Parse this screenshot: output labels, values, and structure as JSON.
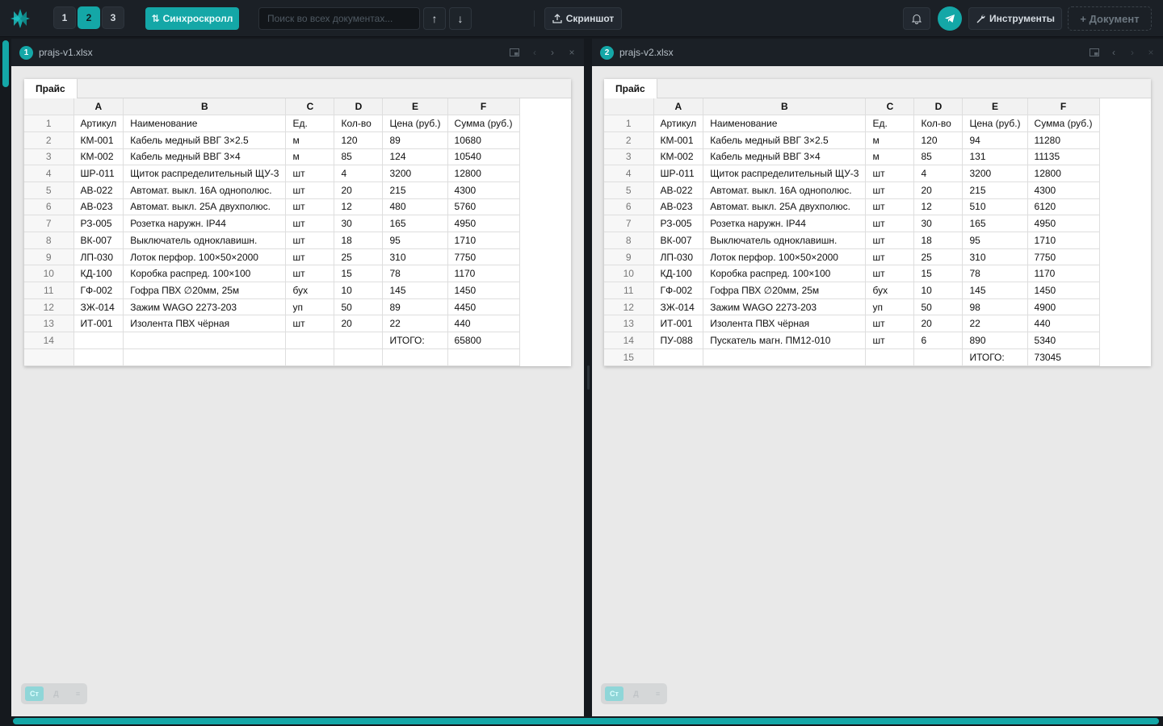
{
  "toolbar": {
    "doc_numbers": [
      "1",
      "2",
      "3"
    ],
    "active_doc": "2",
    "sync_label": "Синхроскролл",
    "search_placeholder": "Поиск во всех документах...",
    "up_arrow": "↑",
    "down_arrow": "↓",
    "screenshot_label": "Скриншот",
    "tools_label": "Инструменты",
    "add_doc_label": "+ Документ"
  },
  "colors": {
    "accent": "#14a7a7",
    "toolbar_bg": "#1b2026",
    "pane_bg": "#e9e9e9"
  },
  "left": {
    "badge": "1",
    "filename": "prajs-v1.xlsx",
    "sheet_tab": "Прайс",
    "columns": [
      "A",
      "B",
      "C",
      "D",
      "E",
      "F"
    ],
    "rows": [
      [
        "1",
        "Артикул",
        "Наименование",
        "Ед.",
        "Кол-во",
        "Цена (руб.)",
        "Сумма (руб.)"
      ],
      [
        "2",
        "КМ-001",
        "Кабель медный ВВГ 3×2.5",
        "м",
        "120",
        "89",
        "10680"
      ],
      [
        "3",
        "КМ-002",
        "Кабель медный ВВГ 3×4",
        "м",
        "85",
        "124",
        "10540"
      ],
      [
        "4",
        "ШР-011",
        "Щиток распределительный ЩУ-3",
        "шт",
        "4",
        "3200",
        "12800"
      ],
      [
        "5",
        "АВ-022",
        "Автомат. выкл. 16А однополюс.",
        "шт",
        "20",
        "215",
        "4300"
      ],
      [
        "6",
        "АВ-023",
        "Автомат. выкл. 25А двухполюс.",
        "шт",
        "12",
        "480",
        "5760"
      ],
      [
        "7",
        "РЗ-005",
        "Розетка наружн. IP44",
        "шт",
        "30",
        "165",
        "4950"
      ],
      [
        "8",
        "ВК-007",
        "Выключатель одноклавишн.",
        "шт",
        "18",
        "95",
        "1710"
      ],
      [
        "9",
        "ЛП-030",
        "Лоток перфор. 100×50×2000",
        "шт",
        "25",
        "310",
        "7750"
      ],
      [
        "10",
        "КД-100",
        "Коробка распред. 100×100",
        "шт",
        "15",
        "78",
        "1170"
      ],
      [
        "11",
        "ГФ-002",
        "Гофра ПВХ ∅20мм, 25м",
        "бух",
        "10",
        "145",
        "1450"
      ],
      [
        "12",
        "ЗЖ-014",
        "Зажим WAGO 2273-203",
        "уп",
        "50",
        "89",
        "4450"
      ],
      [
        "13",
        "ИТ-001",
        "Изолента ПВХ чёрная",
        "шт",
        "20",
        "22",
        "440"
      ],
      [
        "14",
        "",
        "",
        "",
        "",
        "ИТОГО:",
        "65800"
      ],
      [
        "",
        "",
        "",
        "",
        "",
        "",
        ""
      ]
    ]
  },
  "right": {
    "badge": "2",
    "filename": "prajs-v2.xlsx",
    "sheet_tab": "Прайс",
    "columns": [
      "A",
      "B",
      "C",
      "D",
      "E",
      "F"
    ],
    "rows": [
      [
        "1",
        "Артикул",
        "Наименование",
        "Ед.",
        "Кол-во",
        "Цена (руб.)",
        "Сумма (руб.)"
      ],
      [
        "2",
        "КМ-001",
        "Кабель медный ВВГ 3×2.5",
        "м",
        "120",
        "94",
        "11280"
      ],
      [
        "3",
        "КМ-002",
        "Кабель медный ВВГ 3×4",
        "м",
        "85",
        "131",
        "11135"
      ],
      [
        "4",
        "ШР-011",
        "Щиток распределительный ЩУ-3",
        "шт",
        "4",
        "3200",
        "12800"
      ],
      [
        "5",
        "АВ-022",
        "Автомат. выкл. 16А однополюс.",
        "шт",
        "20",
        "215",
        "4300"
      ],
      [
        "6",
        "АВ-023",
        "Автомат. выкл. 25А двухполюс.",
        "шт",
        "12",
        "510",
        "6120"
      ],
      [
        "7",
        "РЗ-005",
        "Розетка наружн. IP44",
        "шт",
        "30",
        "165",
        "4950"
      ],
      [
        "8",
        "ВК-007",
        "Выключатель одноклавишн.",
        "шт",
        "18",
        "95",
        "1710"
      ],
      [
        "9",
        "ЛП-030",
        "Лоток перфор. 100×50×2000",
        "шт",
        "25",
        "310",
        "7750"
      ],
      [
        "10",
        "КД-100",
        "Коробка распред. 100×100",
        "шт",
        "15",
        "78",
        "1170"
      ],
      [
        "11",
        "ГФ-002",
        "Гофра ПВХ ∅20мм, 25м",
        "бух",
        "10",
        "145",
        "1450"
      ],
      [
        "12",
        "ЗЖ-014",
        "Зажим WAGO 2273-203",
        "уп",
        "50",
        "98",
        "4900"
      ],
      [
        "13",
        "ИТ-001",
        "Изолента ПВХ чёрная",
        "шт",
        "20",
        "22",
        "440"
      ],
      [
        "14",
        "ПУ-088",
        "Пускатель магн. ПМ12-010",
        "шт",
        "6",
        "890",
        "5340"
      ],
      [
        "15",
        "",
        "",
        "",
        "",
        "ИТОГО:",
        "73045"
      ]
    ]
  },
  "mini_toolbar": [
    "Ст",
    "Д",
    "≡"
  ]
}
